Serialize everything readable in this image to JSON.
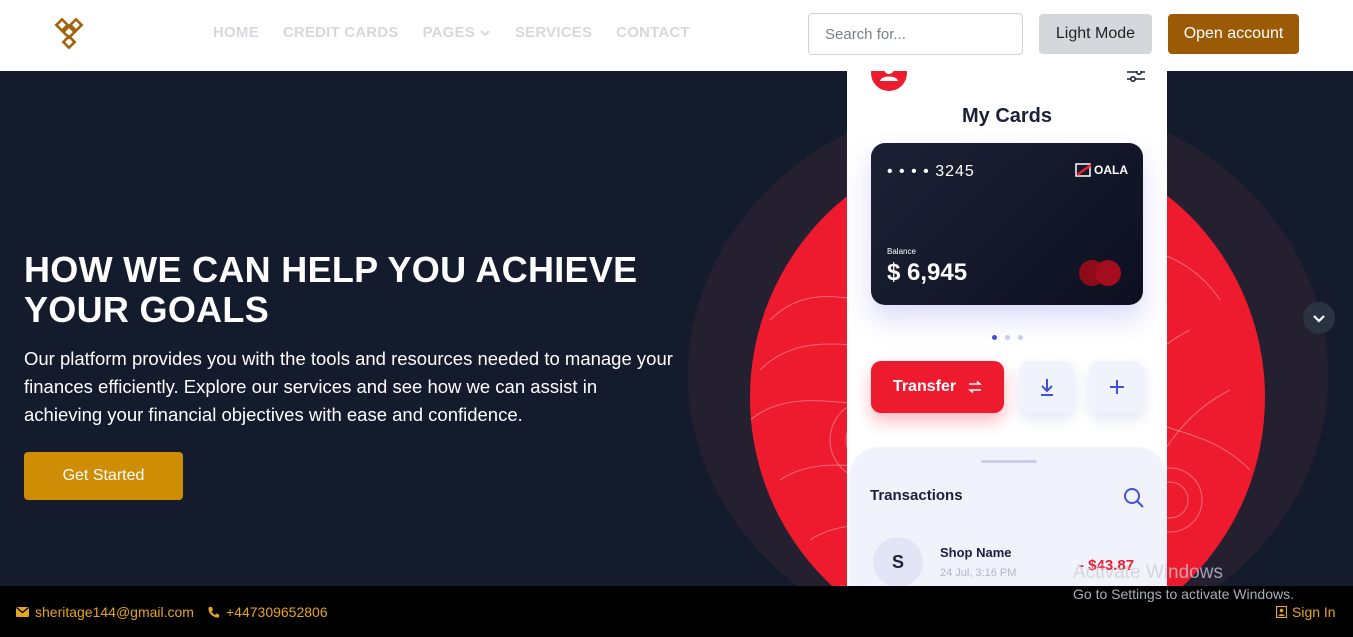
{
  "nav": {
    "logo_icon": "diamond-lattice-logo",
    "links": [
      "HOME",
      "CREDIT CARDS",
      "PAGES",
      "SERVICES",
      "CONTACT"
    ],
    "search_placeholder": "Search for...",
    "light_mode_label": "Light Mode",
    "open_account_label": "Open account"
  },
  "hero": {
    "title": "HOW WE CAN HELP YOU ACHIEVE YOUR GOALS",
    "description": "Our platform provides you with the tools and resources needed to manage your finances efficiently. Explore our services and see how we can assist in achieving your financial objectives with ease and confidence.",
    "cta_label": "Get Started"
  },
  "phone": {
    "title": "My Cards",
    "card": {
      "number": "• • • • 3245",
      "brand": "OALA",
      "balance_label": "Balance",
      "balance": "$ 6,945"
    },
    "transfer_label": "Transfer",
    "transactions": {
      "title": "Transactions",
      "items": [
        {
          "initial": "S",
          "name": "Shop Name",
          "date": "24 Jul, 3:16 PM",
          "amount": "- $43.87"
        }
      ]
    }
  },
  "watermark": {
    "title": "Activate Windows",
    "subtitle": "Go to Settings to activate Windows."
  },
  "footer": {
    "email": "sheritage144@gmail.com",
    "phone": "+447309652806",
    "signin": "Sign In"
  },
  "colors": {
    "accent_gold": "#cf8c05",
    "accent_brown": "#9b5a06",
    "hero_bg": "#141b2d",
    "red": "#ee1b2e"
  }
}
